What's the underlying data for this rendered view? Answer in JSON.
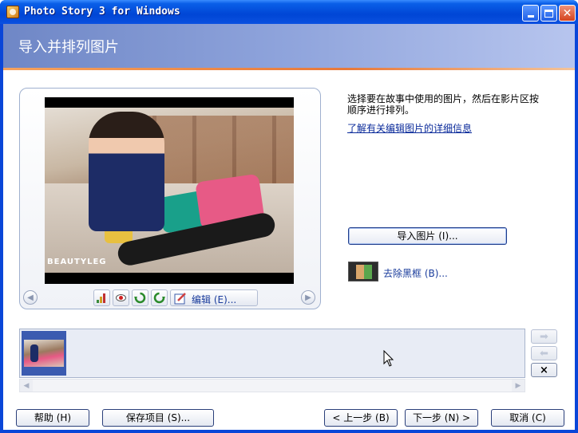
{
  "window": {
    "title": "Photo Story 3 for Windows"
  },
  "page": {
    "title": "导入并排列图片"
  },
  "preview": {
    "watermark": "BEAUTYLEG"
  },
  "edit_toolbar": {
    "edit_label": "编辑 (E)..."
  },
  "right_panel": {
    "instructions": "选择要在故事中使用的图片，然后在影片区按顺序进行排列。",
    "learn_more_link": "了解有关编辑图片的详细信息",
    "import_button": "导入图片 (I)...",
    "remove_borders_link": "去除黑框 (B)..."
  },
  "filmstrip": {
    "thumbnails": 1,
    "delete_label": "×"
  },
  "bottom_buttons": {
    "help": "帮助 (H)",
    "save": "保存项目 (S)...",
    "back": "< 上一步 (B)",
    "next": "下一步 (N) >",
    "cancel": "取消 (C)"
  },
  "colors": {
    "titlebar": "#0046d5",
    "header": "#8fa4dc",
    "accent_line": "#e8793a",
    "link": "#0a2a9a"
  }
}
